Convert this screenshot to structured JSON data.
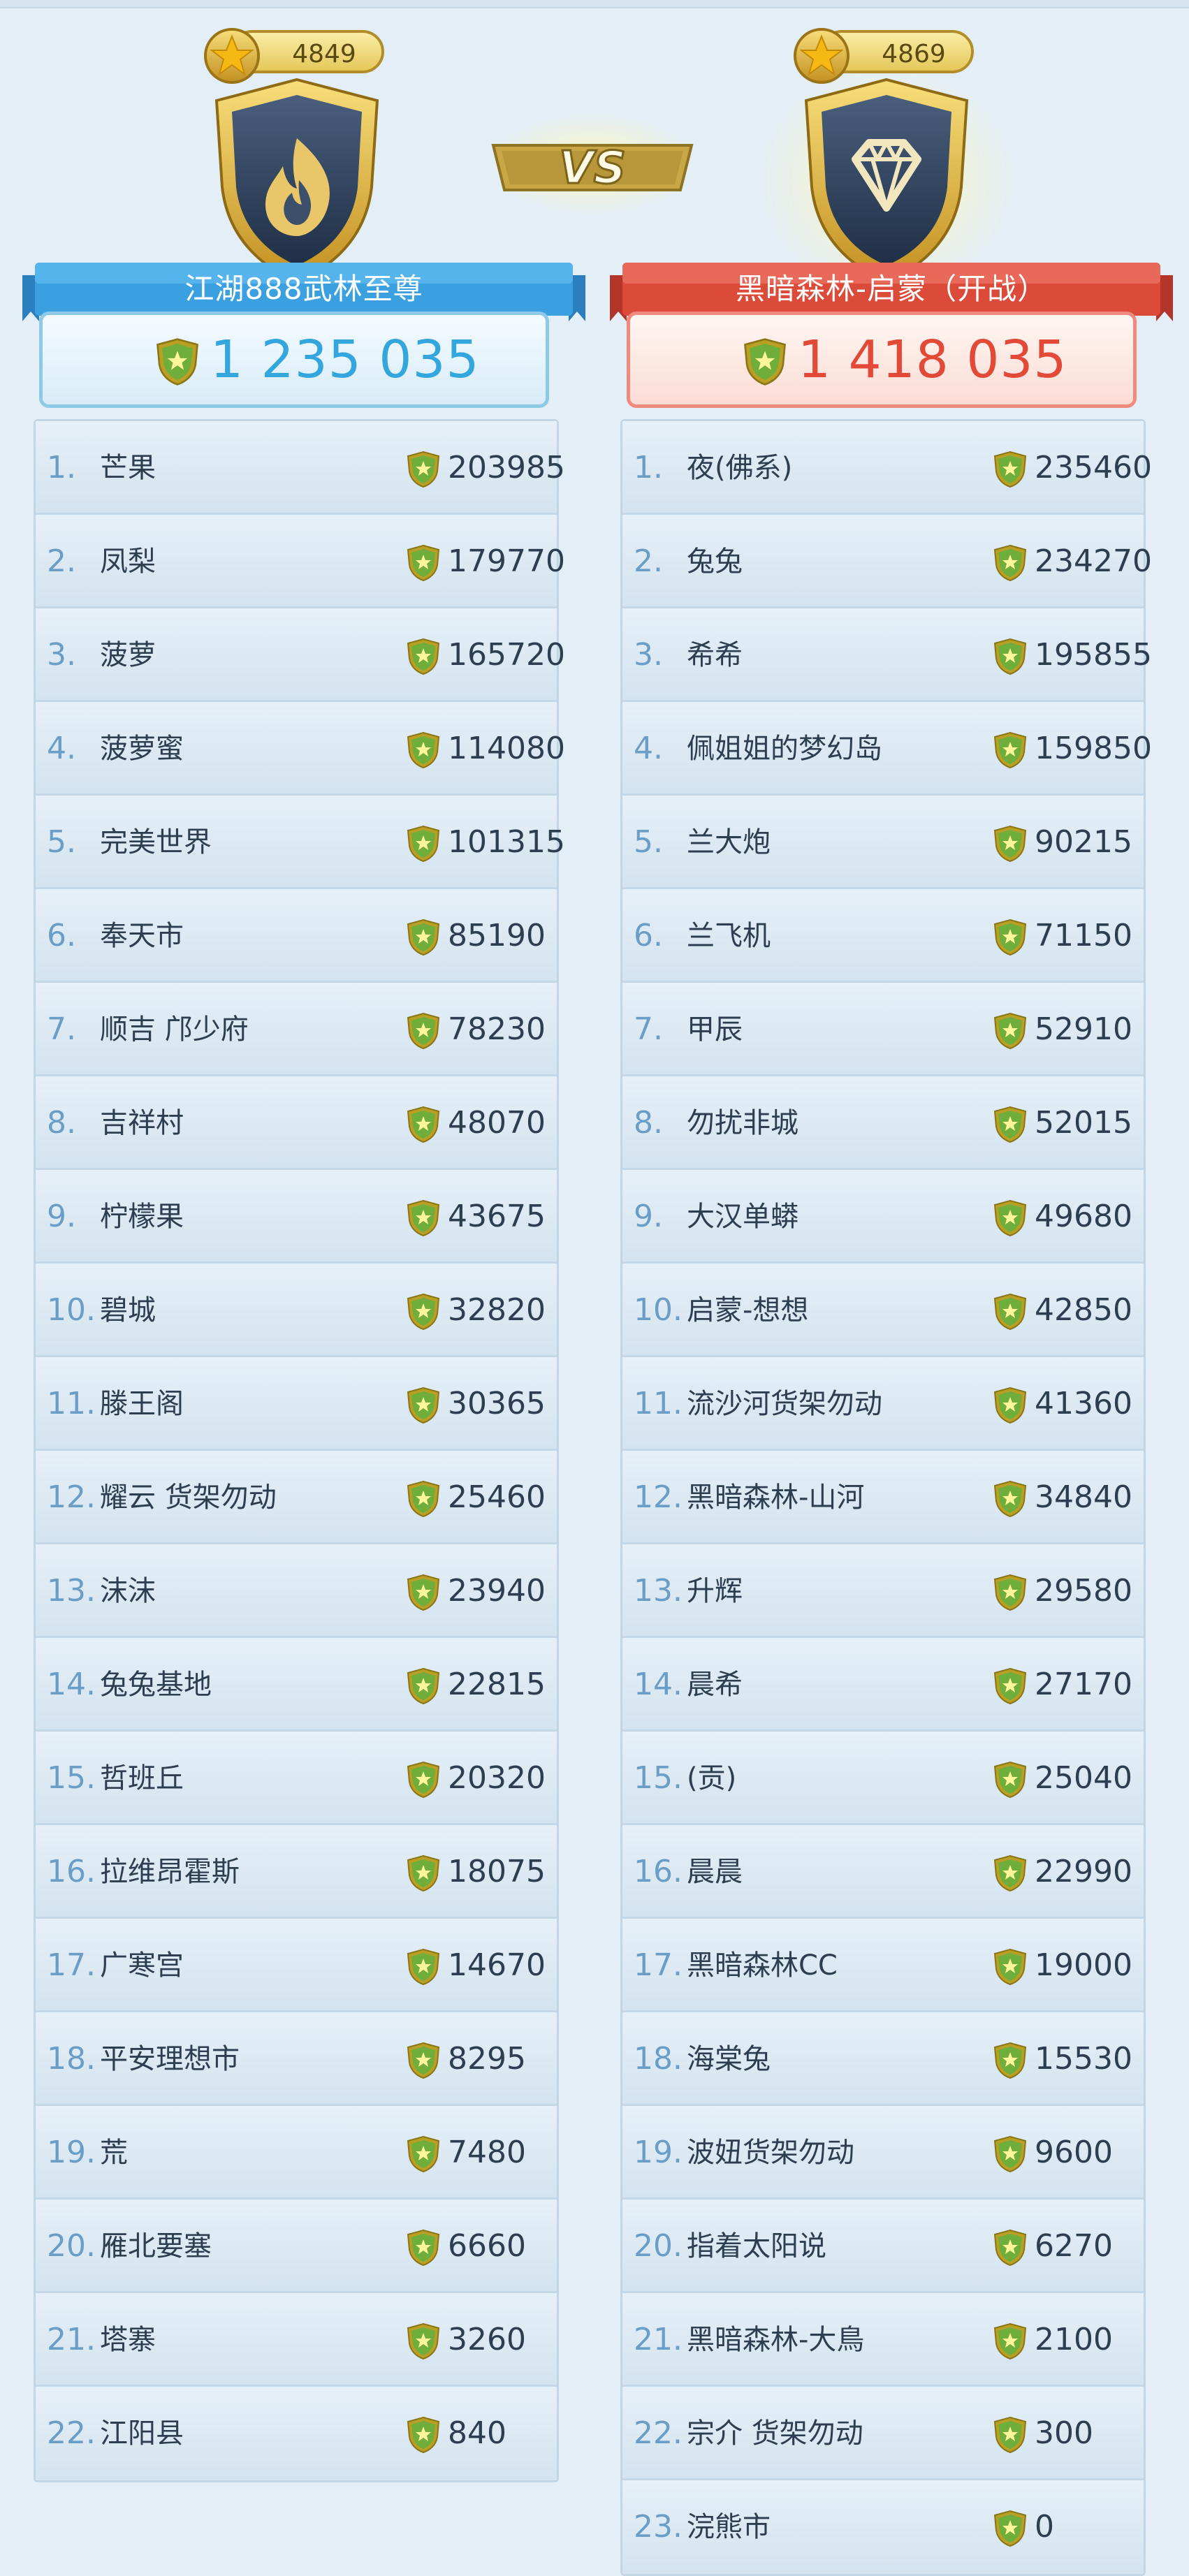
{
  "left": {
    "trophy_score": "4849",
    "team_name": "江湖888武林至尊",
    "total": "1 235 035",
    "members": [
      {
        "rank": "1.",
        "name": "芒果",
        "points": "203985"
      },
      {
        "rank": "2.",
        "name": "凤梨",
        "points": "179770"
      },
      {
        "rank": "3.",
        "name": "菠萝",
        "points": "165720"
      },
      {
        "rank": "4.",
        "name": "菠萝蜜",
        "points": "114080"
      },
      {
        "rank": "5.",
        "name": "完美世界",
        "points": "101315"
      },
      {
        "rank": "6.",
        "name": "奉天市",
        "points": "85190"
      },
      {
        "rank": "7.",
        "name": "顺吉 邝少府",
        "points": "78230"
      },
      {
        "rank": "8.",
        "name": "吉祥村",
        "points": "48070"
      },
      {
        "rank": "9.",
        "name": "柠檬果",
        "points": "43675"
      },
      {
        "rank": "10.",
        "name": "碧城",
        "points": "32820"
      },
      {
        "rank": "11.",
        "name": "滕王阁",
        "points": "30365"
      },
      {
        "rank": "12.",
        "name": "耀云 货架勿动",
        "points": "25460"
      },
      {
        "rank": "13.",
        "name": "沫沫",
        "points": "23940"
      },
      {
        "rank": "14.",
        "name": "兔兔基地",
        "points": "22815"
      },
      {
        "rank": "15.",
        "name": "哲班丘",
        "points": "20320"
      },
      {
        "rank": "16.",
        "name": "拉维昂霍斯",
        "points": "18075"
      },
      {
        "rank": "17.",
        "name": "广寒宫",
        "points": "14670"
      },
      {
        "rank": "18.",
        "name": "平安理想市",
        "points": "8295"
      },
      {
        "rank": "19.",
        "name": "荒",
        "points": "7480"
      },
      {
        "rank": "20.",
        "name": "雁北要塞",
        "points": "6660"
      },
      {
        "rank": "21.",
        "name": "塔寨",
        "points": "3260"
      },
      {
        "rank": "22.",
        "name": "江阳县",
        "points": "840"
      }
    ]
  },
  "vs_label": "VS",
  "right": {
    "trophy_score": "4869",
    "team_name": "黑暗森林-启蒙（开战）",
    "total": "1 418 035",
    "members": [
      {
        "rank": "1.",
        "name": "夜(佛系)",
        "points": "235460"
      },
      {
        "rank": "2.",
        "name": "兔兔",
        "points": "234270"
      },
      {
        "rank": "3.",
        "name": "希希",
        "points": "195855"
      },
      {
        "rank": "4.",
        "name": "佩姐姐的梦幻岛",
        "points": "159850"
      },
      {
        "rank": "5.",
        "name": "兰大炮",
        "points": "90215"
      },
      {
        "rank": "6.",
        "name": "兰飞机",
        "points": "71150"
      },
      {
        "rank": "7.",
        "name": "甲辰",
        "points": "52910"
      },
      {
        "rank": "8.",
        "name": "勿扰非城",
        "points": "52015"
      },
      {
        "rank": "9.",
        "name": "大汉单蟒",
        "points": "49680"
      },
      {
        "rank": "10.",
        "name": "启蒙-想想",
        "points": "42850"
      },
      {
        "rank": "11.",
        "name": "流沙河货架勿动",
        "points": "41360"
      },
      {
        "rank": "12.",
        "name": "黑暗森林-山河",
        "points": "34840"
      },
      {
        "rank": "13.",
        "name": "升辉",
        "points": "29580"
      },
      {
        "rank": "14.",
        "name": "晨希",
        "points": "27170"
      },
      {
        "rank": "15.",
        "name": "(贡)",
        "points": "25040"
      },
      {
        "rank": "16.",
        "name": "晨晨",
        "points": "22990"
      },
      {
        "rank": "17.",
        "name": "黑暗森林CC",
        "points": "19000"
      },
      {
        "rank": "18.",
        "name": "海棠兔",
        "points": "15530"
      },
      {
        "rank": "19.",
        "name": "波妞货架勿动",
        "points": "9600"
      },
      {
        "rank": "20.",
        "name": "指着太阳说",
        "points": "6270"
      },
      {
        "rank": "21.",
        "name": "黑暗森林-大鳥",
        "points": "2100"
      },
      {
        "rank": "22.",
        "name": "宗介 货架勿动",
        "points": "300"
      },
      {
        "rank": "23.",
        "name": "浣熊市",
        "points": "0"
      }
    ]
  },
  "icons": {
    "coin": "star-coin-icon",
    "left_emblem": "flame-shield-icon",
    "right_emblem": "diamond-shield-icon",
    "points": "shield-star-icon"
  },
  "colors": {
    "left_accent": "#33a6dd",
    "right_accent": "#e24a37",
    "gold": "#e6c85a"
  }
}
